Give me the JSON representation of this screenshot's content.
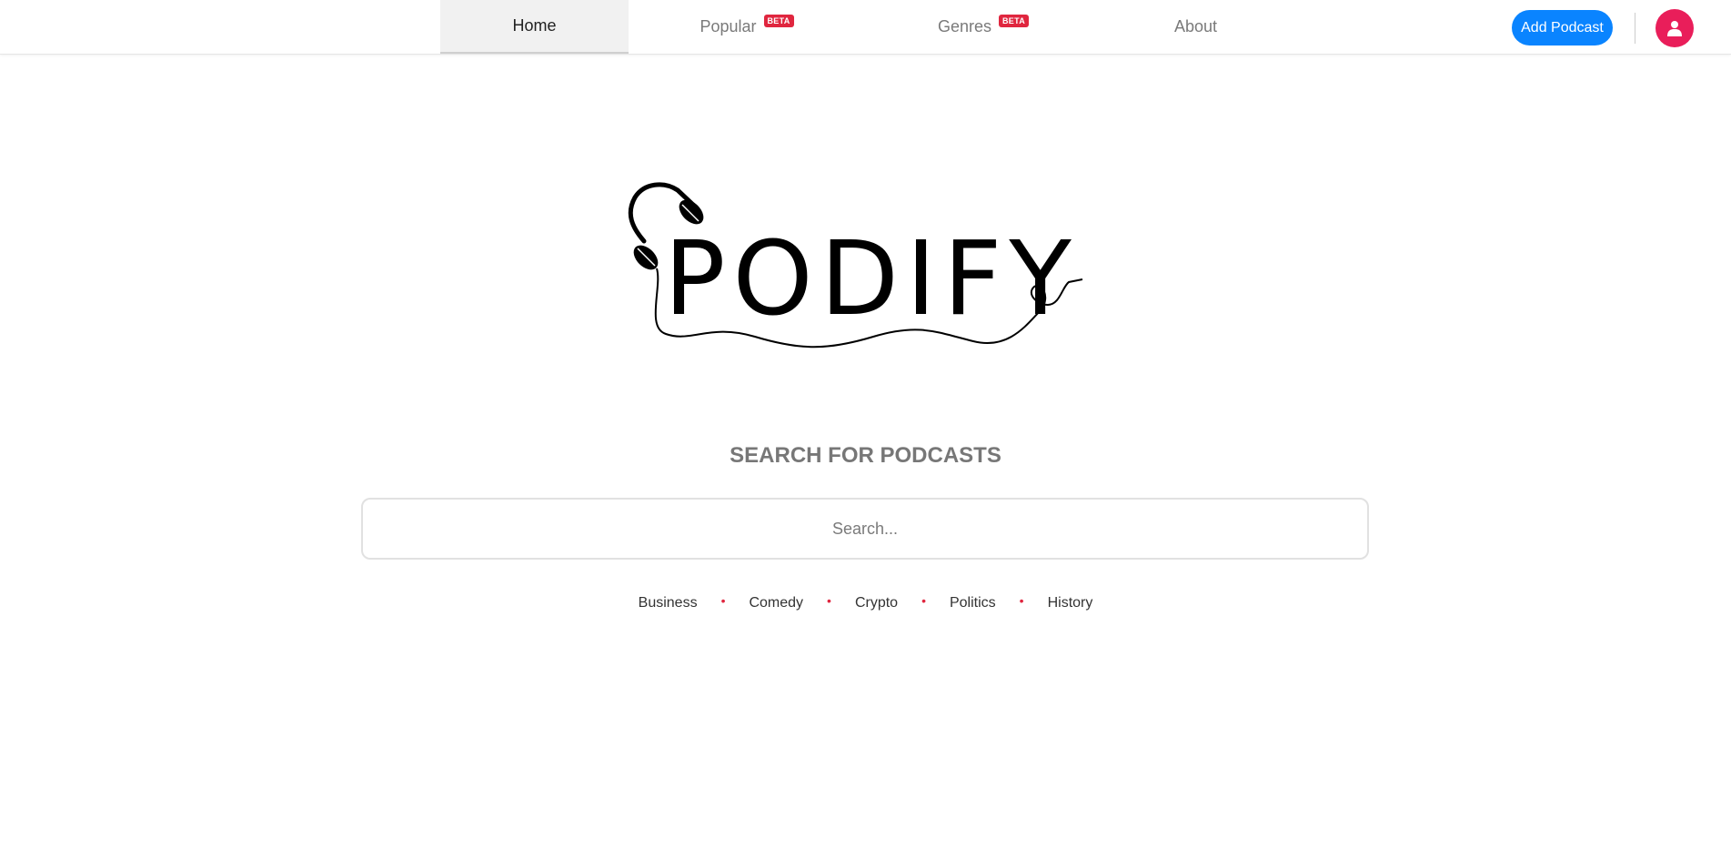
{
  "nav": {
    "tabs": [
      {
        "label": "Home",
        "active": true
      },
      {
        "label": "Popular",
        "badge": "BETA"
      },
      {
        "label": "Genres",
        "badge": "BETA"
      },
      {
        "label": "About"
      }
    ],
    "add_podcast_label": "Add Podcast",
    "avatar_icon": "user-icon"
  },
  "logo": {
    "text": "PODIFY",
    "icon": "headphones-icon"
  },
  "search": {
    "heading": "SEARCH FOR PODCASTS",
    "placeholder": "Search..."
  },
  "genres": [
    "Business",
    "Comedy",
    "Crypto",
    "Politics",
    "History"
  ],
  "colors": {
    "accent_blue": "#0a84ff",
    "avatar_pink": "#e91e5a",
    "badge_red": "#e0263f",
    "dot_red": "#e0263f"
  }
}
